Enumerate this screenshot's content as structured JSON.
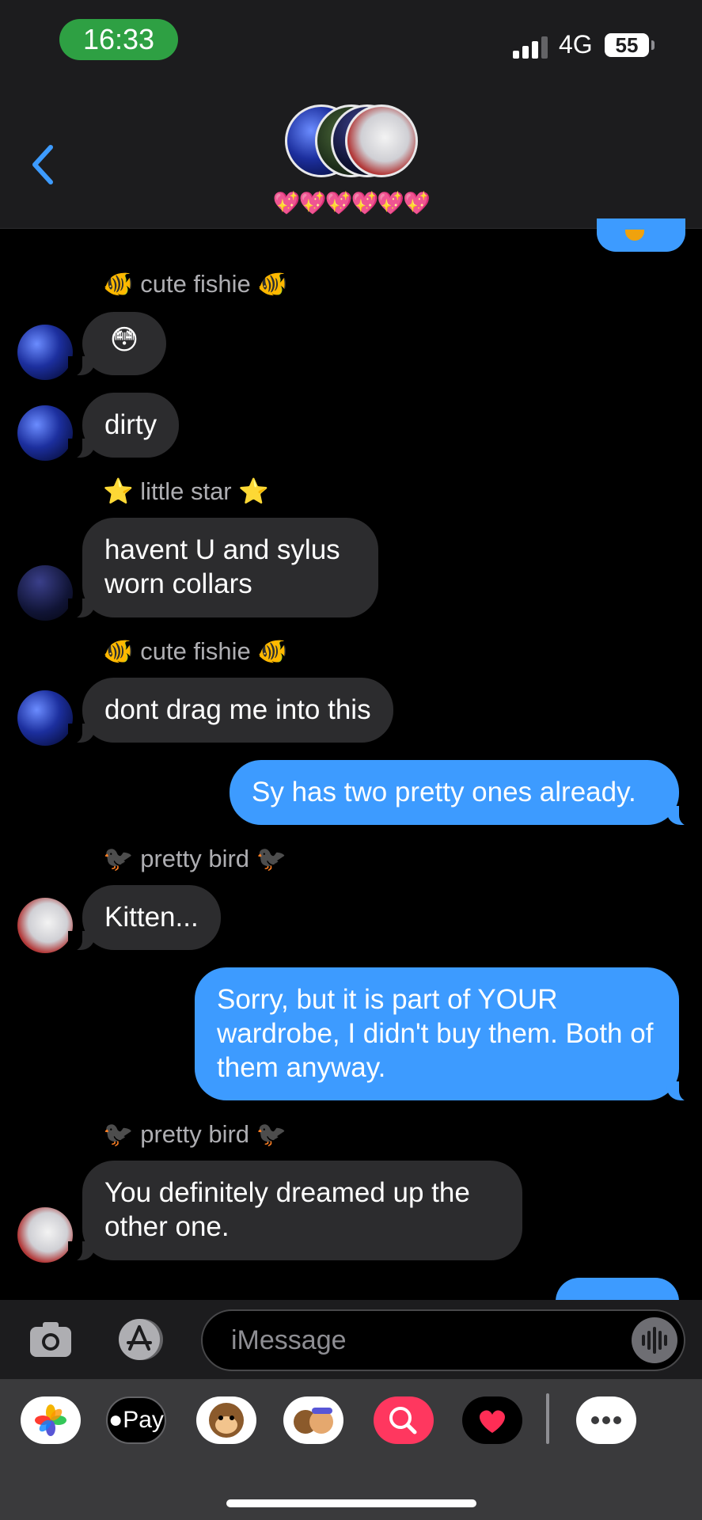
{
  "status_bar": {
    "time": "16:33",
    "network": "4G",
    "battery": "55"
  },
  "header": {
    "group_name": "💖💖💖💖💖💖"
  },
  "messages": [
    {
      "type": "sender",
      "text": "🐠 cute fishie 🐠"
    },
    {
      "type": "in",
      "text": "😳"
    },
    {
      "type": "in",
      "text": "dirty"
    },
    {
      "type": "sender",
      "text": "⭐ little star ⭐"
    },
    {
      "type": "in",
      "text": "havent U and sylus worn collars"
    },
    {
      "type": "sender",
      "text": "🐠 cute fishie 🐠"
    },
    {
      "type": "in",
      "text": "dont drag me into this"
    },
    {
      "type": "out",
      "text": "Sy has two pretty ones already."
    },
    {
      "type": "sender",
      "text": "🐦‍⬛ pretty bird 🐦‍⬛"
    },
    {
      "type": "in",
      "text": "Kitten..."
    },
    {
      "type": "out",
      "text": "Sorry, but it is part of YOUR wardrobe, I didn't buy them. Both of them anyway."
    },
    {
      "type": "sender",
      "text": "🐦‍⬛ pretty bird 🐦‍⬛"
    },
    {
      "type": "in",
      "text": "You definitely dreamed up the other one."
    }
  ],
  "input": {
    "placeholder": "iMessage"
  },
  "drawer": {
    "apple_pay_label": "Pay",
    "apps": [
      "photos-icon",
      "apple-pay-icon",
      "monkey-memoji-icon",
      "memoji-icon",
      "image-search-icon",
      "digital-touch-icon",
      "more-icon"
    ]
  }
}
